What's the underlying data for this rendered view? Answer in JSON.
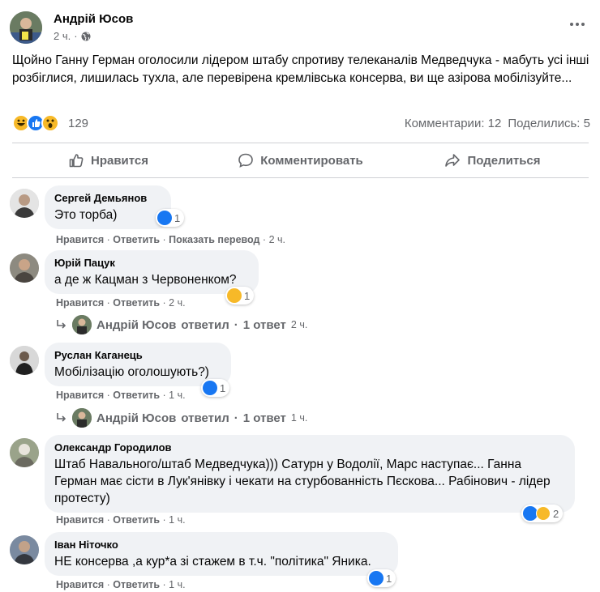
{
  "post": {
    "author": "Андрій Юсов",
    "time": "2 ч.",
    "text": "Щойно Ганну Герман оголосили лідером штабу спротиву телеканалів Медведчука - мабуть усі інші розбіглися, лишилась тухла, але перевірена кремлівська консерва, ви ще азірова мобілізуйте...",
    "reaction_count": "129",
    "comments_count": "Комментарии: 12",
    "shares_count": "Поделились: 5"
  },
  "actions": {
    "like": "Нравится",
    "comment": "Комментировать",
    "share": "Поделиться"
  },
  "comments": [
    {
      "author": "Сергей Демьянов",
      "text": "Это торба)",
      "reactions": "1",
      "actions": {
        "like": "Нравится",
        "reply": "Ответить",
        "translate": "Показать перевод",
        "time": "2 ч."
      }
    },
    {
      "author": "Юрій Пацук",
      "text": "а де ж Кацман з Червоненком?",
      "reactions": "1",
      "actions": {
        "like": "Нравится",
        "reply": "Ответить",
        "time": "2 ч."
      },
      "reply": {
        "author": "Андрій Юсов",
        "label": "ответил",
        "count": "1 ответ",
        "time": "2 ч."
      }
    },
    {
      "author": "Руслан Каганець",
      "text": "Мобілізацію оголошують?)",
      "reactions": "1",
      "actions": {
        "like": "Нравится",
        "reply": "Ответить",
        "time": "1 ч."
      },
      "reply": {
        "author": "Андрій Юсов",
        "label": "ответил",
        "count": "1 ответ",
        "time": "1 ч."
      }
    },
    {
      "author": "Олександр Городилов",
      "text": "Штаб Навального/штаб Медведчука))) Сатурн у Водолії, Марс наступає... Ганна Герман має сісти в Лук'янівку і чекати на стурбованність Пєскова... Рабінович - лідер протесту)",
      "reactions": "2",
      "actions": {
        "like": "Нравится",
        "reply": "Ответить",
        "time": "1 ч."
      }
    },
    {
      "author": "Іван Ніточко",
      "text": "НЕ консерва ,а кур*а зі стажем в т.ч. \"політика\" Яника.",
      "reactions": "1",
      "actions": {
        "like": "Нравится",
        "reply": "Ответить",
        "time": "1 ч."
      }
    }
  ],
  "icons": [
    "globe-icon",
    "more-icon",
    "like-icon",
    "comment-icon",
    "share-icon",
    "reply-arrow-icon",
    "haha-reaction-icon",
    "like-reaction-icon",
    "wow-reaction-icon"
  ],
  "colors": {
    "link_blue": "#1877f2",
    "secondary_text": "#65676b",
    "bubble_bg": "#f0f2f5",
    "divider": "#ced0d4"
  }
}
